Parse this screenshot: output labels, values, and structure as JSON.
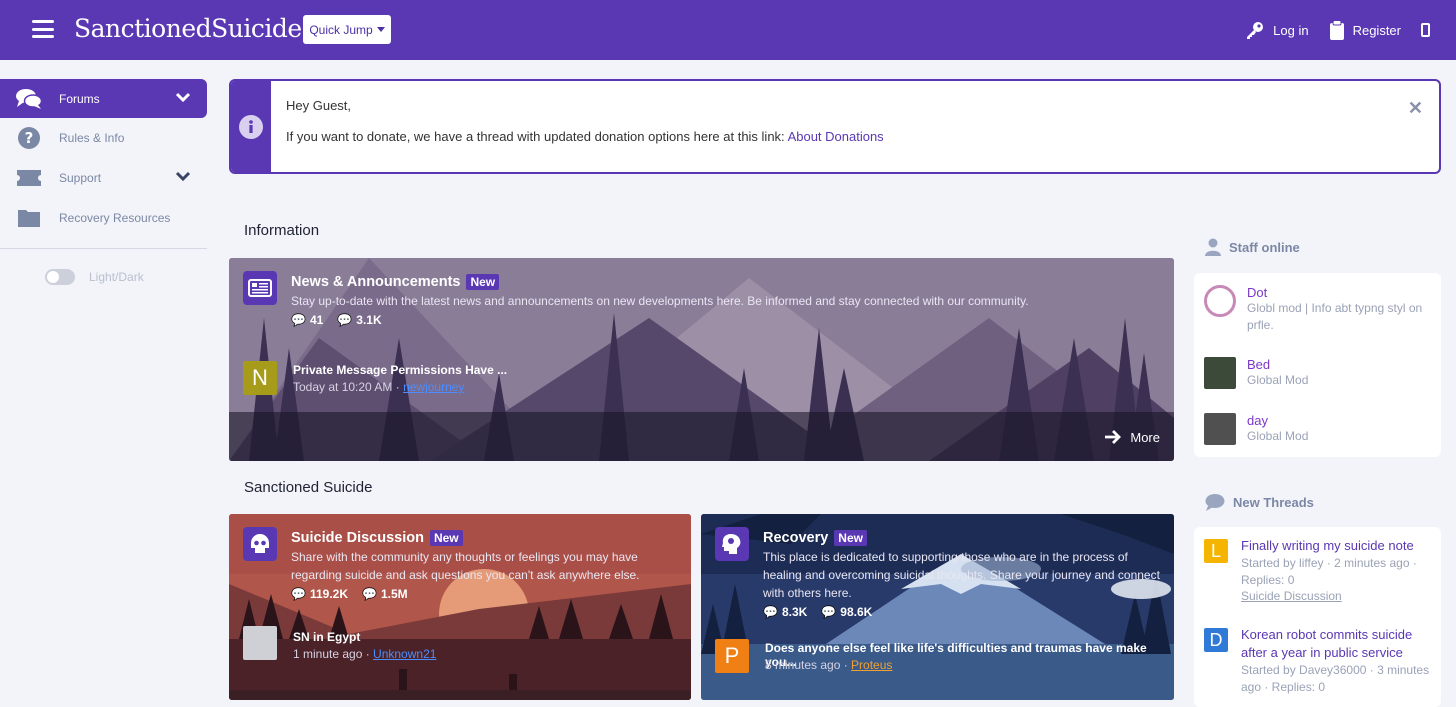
{
  "header": {
    "logo": "SanctionedSuicide.",
    "quick_jump": "Quick Jump",
    "login": "Log in",
    "register": "Register",
    "bg_color": "#5a37b3"
  },
  "sidebar": {
    "items": [
      {
        "label": "Forums",
        "icon": "chat-bubbles-icon",
        "active": true
      },
      {
        "label": "Rules & Info",
        "icon": "question-circle-icon"
      },
      {
        "label": "Support",
        "icon": "ticket-icon"
      },
      {
        "label": "Recovery Resources",
        "icon": "folder-icon"
      }
    ],
    "theme_toggle_label": "Light/Dark"
  },
  "notice": {
    "greeting": "Hey Guest,",
    "text": "If you want to donate, we have a thread with updated donation options here at this link: ",
    "link": "About Donations"
  },
  "sections": {
    "information": "Information",
    "sanctioned": "Sanctioned Suicide"
  },
  "forums": {
    "news": {
      "title": "News & Announcements",
      "badge": "New",
      "desc": "Stay up-to-date with the latest news and announcements on new developments here. Be informed and stay connected with our community.",
      "threads": "41",
      "messages": "3.1K",
      "latest_avatar": "N",
      "latest_title": "Private Message Permissions Have ...",
      "latest_time": "Today at 10:20 AM · ",
      "latest_user": "newjourney",
      "more": "More"
    },
    "discussion": {
      "title": "Suicide Discussion",
      "badge": "New",
      "desc1": "Share with the community any thoughts or feelings you may have",
      "desc2": "regarding suicide and ask questions you can't ask anywhere else.",
      "threads": "119.2K",
      "messages": "1.5M",
      "latest_title": "SN in Egypt",
      "latest_time": "1 minute ago · ",
      "latest_user": "Unknown21"
    },
    "recovery": {
      "title": "Recovery",
      "badge": "New",
      "desc1": "This place is dedicated to supporting those who are in the process of",
      "desc2": "healing and overcoming suicidal thoughts. Share your journey and connect",
      "desc3": "with others here.",
      "threads": "8.3K",
      "messages": "98.6K",
      "latest_avatar": "P",
      "latest_title": "Does anyone else feel like life's difficulties and traumas have make you...",
      "latest_time": "8 minutes ago · ",
      "latest_user": "Proteus"
    }
  },
  "staff_online": {
    "title": "Staff online",
    "members": [
      {
        "name": "Dot",
        "role1": "Globl mod | Info abt typng styl on",
        "role2": "prfle."
      },
      {
        "name": "Bed",
        "role1": "Global Mod"
      },
      {
        "name": "day",
        "role1": "Global Mod"
      }
    ]
  },
  "new_threads": {
    "title": "New Threads",
    "items": [
      {
        "avatar": "L",
        "title": "Finally writing my suicide note",
        "meta1": "Started by liffey · 2 minutes ago ·",
        "meta2": "Replies: 0",
        "forum": "Suicide Discussion",
        "color": "#f5b400"
      },
      {
        "avatar": "D",
        "title1": "Korean robot commits suicide",
        "title2": "after a year in public service",
        "meta1": "Started by Davey36000 · 3 minutes",
        "meta2": "ago · Replies: 0",
        "color": "#2f7ad6"
      }
    ]
  }
}
